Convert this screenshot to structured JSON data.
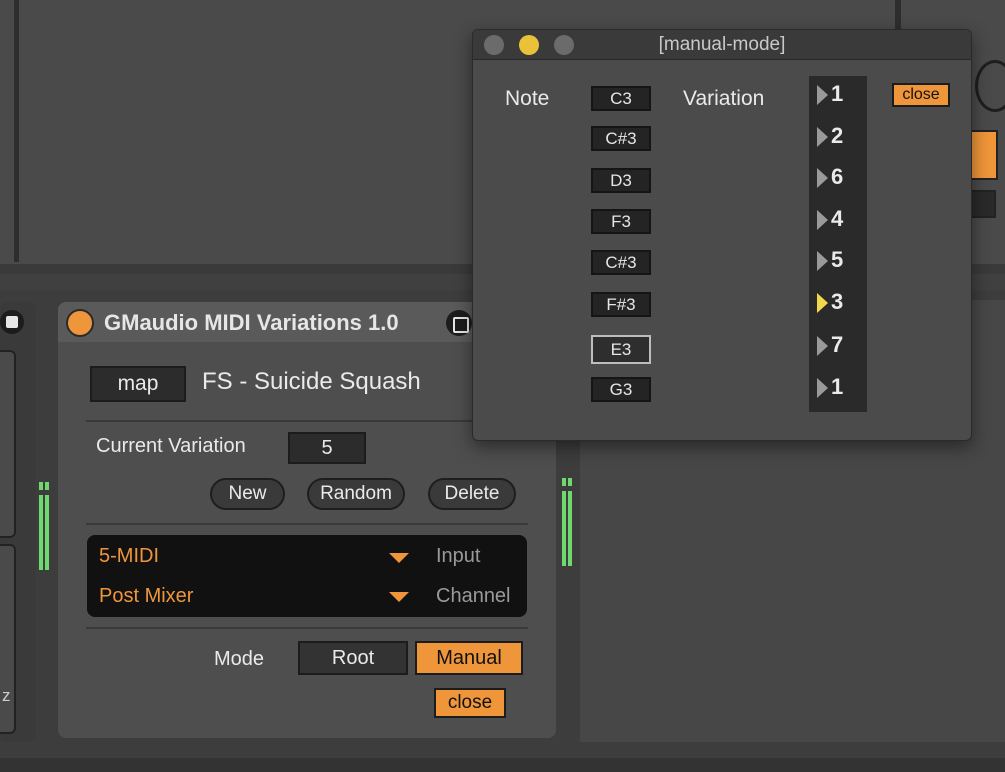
{
  "device": {
    "title": "GMaudio MIDI Variations 1.0",
    "map_label": "map",
    "preset_name": "FS - Suicide Squash",
    "current_variation_label": "Current Variation",
    "current_variation_value": "5",
    "buttons": {
      "new": "New",
      "random": "Random",
      "delete": "Delete"
    },
    "routing": {
      "input_value": "5-MIDI",
      "input_label": "Input",
      "channel_value": "Post Mixer",
      "channel_label": "Channel"
    },
    "mode_label": "Mode",
    "mode_options": {
      "root": "Root",
      "manual": "Manual"
    },
    "mode_selected": "Manual",
    "close_label": "close"
  },
  "left_device": {
    "fragment_text": "z"
  },
  "popup": {
    "title": "[manual-mode]",
    "note_header": "Note",
    "variation_header": "Variation",
    "close_label": "close",
    "notes": [
      "C3",
      "C#3",
      "D3",
      "F3",
      "C#3",
      "F#3",
      "E3",
      "G3"
    ],
    "variations": [
      "1",
      "2",
      "6",
      "4",
      "5",
      "3",
      "7",
      "1"
    ],
    "active_variation_row": 5,
    "selected_note_row": 6
  },
  "colors": {
    "accent_orange": "#f0963a",
    "active_arrow": "#f3d84a",
    "meter_green": "#6fd86f",
    "traffic_close": "#6b6b6b",
    "traffic_minimize": "#e9c23a",
    "traffic_zoom": "#6b6b6b"
  }
}
